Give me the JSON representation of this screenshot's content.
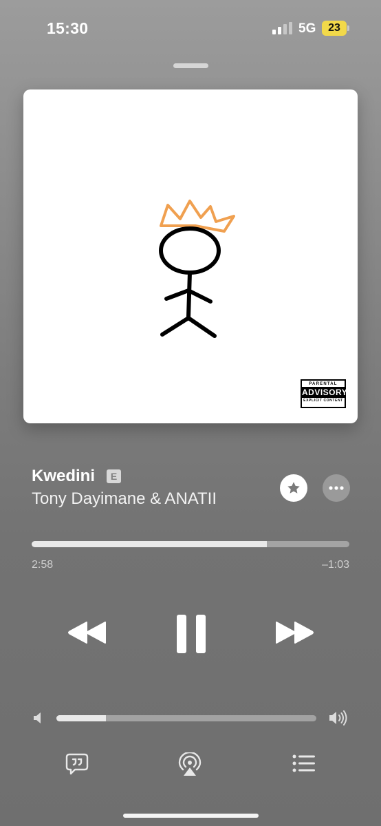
{
  "status_bar": {
    "time": "15:30",
    "network": "5G",
    "battery": "23"
  },
  "artwork": {
    "advisory_top": "PARENTAL",
    "advisory_main": "ADVISORY",
    "advisory_bottom": "EXPLICIT CONTENT"
  },
  "track": {
    "title": "Kwedini",
    "explicit_badge": "E",
    "artist": "Tony Dayimane & ANATII"
  },
  "progress": {
    "elapsed": "2:58",
    "remaining": "–1:03",
    "fraction": 0.74
  },
  "volume": {
    "fraction": 0.19
  },
  "icons": {
    "favorite": "star-icon",
    "more": "ellipsis-icon",
    "rewind": "rewind-icon",
    "pause": "pause-icon",
    "forward": "fast-forward-icon",
    "volume_low": "speaker-low-icon",
    "volume_high": "speaker-high-icon",
    "lyrics": "lyrics-quote-icon",
    "airplay": "airplay-icon",
    "queue": "queue-list-icon"
  },
  "colors": {
    "crown": "#f0a050",
    "battery": "#f2d94a"
  }
}
